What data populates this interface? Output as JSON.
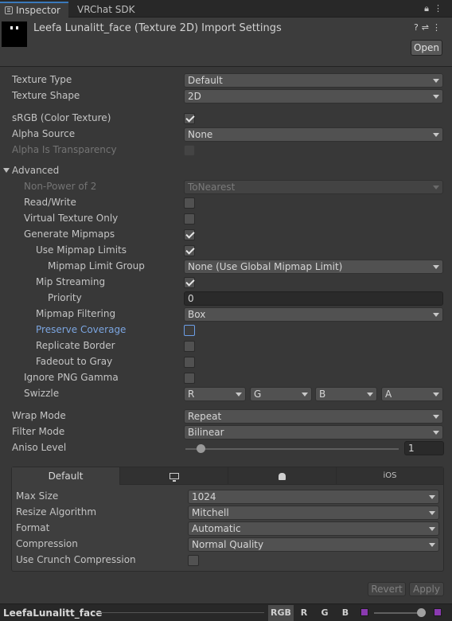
{
  "tabs": {
    "inspector": "Inspector",
    "vrchat": "VRChat SDK"
  },
  "header": {
    "title": "Leefa Lunalitt_face (Texture 2D) Import Settings",
    "open_label": "Open"
  },
  "fields": {
    "texture_type": {
      "label": "Texture Type",
      "value": "Default"
    },
    "texture_shape": {
      "label": "Texture Shape",
      "value": "2D"
    },
    "srgb": {
      "label": "sRGB (Color Texture)",
      "checked": true
    },
    "alpha_source": {
      "label": "Alpha Source",
      "value": "None"
    },
    "alpha_is_transparency": {
      "label": "Alpha Is Transparency",
      "checked": false
    },
    "advanced": {
      "label": "Advanced"
    },
    "non_power_of_2": {
      "label": "Non-Power of 2",
      "value": "ToNearest"
    },
    "read_write": {
      "label": "Read/Write",
      "checked": false
    },
    "virtual_texture_only": {
      "label": "Virtual Texture Only",
      "checked": false
    },
    "generate_mipmaps": {
      "label": "Generate Mipmaps",
      "checked": true
    },
    "use_mipmap_limits": {
      "label": "Use Mipmap Limits",
      "checked": true
    },
    "mipmap_limit_group": {
      "label": "Mipmap Limit Group",
      "value": "None (Use Global Mipmap Limit)"
    },
    "mip_streaming": {
      "label": "Mip Streaming",
      "checked": true
    },
    "priority": {
      "label": "Priority",
      "value": "0"
    },
    "mipmap_filtering": {
      "label": "Mipmap Filtering",
      "value": "Box"
    },
    "preserve_coverage": {
      "label": "Preserve Coverage",
      "checked": false
    },
    "replicate_border": {
      "label": "Replicate Border",
      "checked": false
    },
    "fadeout_to_gray": {
      "label": "Fadeout to Gray",
      "checked": false
    },
    "ignore_png_gamma": {
      "label": "Ignore PNG Gamma",
      "checked": false
    },
    "swizzle": {
      "label": "Swizzle",
      "values": [
        "R",
        "G",
        "B",
        "A"
      ]
    },
    "wrap_mode": {
      "label": "Wrap Mode",
      "value": "Repeat"
    },
    "filter_mode": {
      "label": "Filter Mode",
      "value": "Bilinear"
    },
    "aniso_level": {
      "label": "Aniso Level",
      "value": "1",
      "slider_fraction": 0.0625
    }
  },
  "platform": {
    "tabs": [
      "Default",
      "monitor-icon",
      "android-icon",
      "iOS"
    ],
    "max_size": {
      "label": "Max Size",
      "value": "1024"
    },
    "resize_algorithm": {
      "label": "Resize Algorithm",
      "value": "Mitchell"
    },
    "format": {
      "label": "Format",
      "value": "Automatic"
    },
    "compression": {
      "label": "Compression",
      "value": "Normal Quality"
    },
    "use_crunch": {
      "label": "Use Crunch Compression",
      "checked": false
    }
  },
  "actions": {
    "revert": "Revert",
    "apply": "Apply"
  },
  "preview": {
    "name": "LeefaLunalitt_face",
    "channels": [
      "RGB",
      "R",
      "G",
      "B"
    ]
  },
  "colors": {
    "accent": "#3a79bb",
    "background": "#383838",
    "link_label": "#7ba5e0"
  }
}
